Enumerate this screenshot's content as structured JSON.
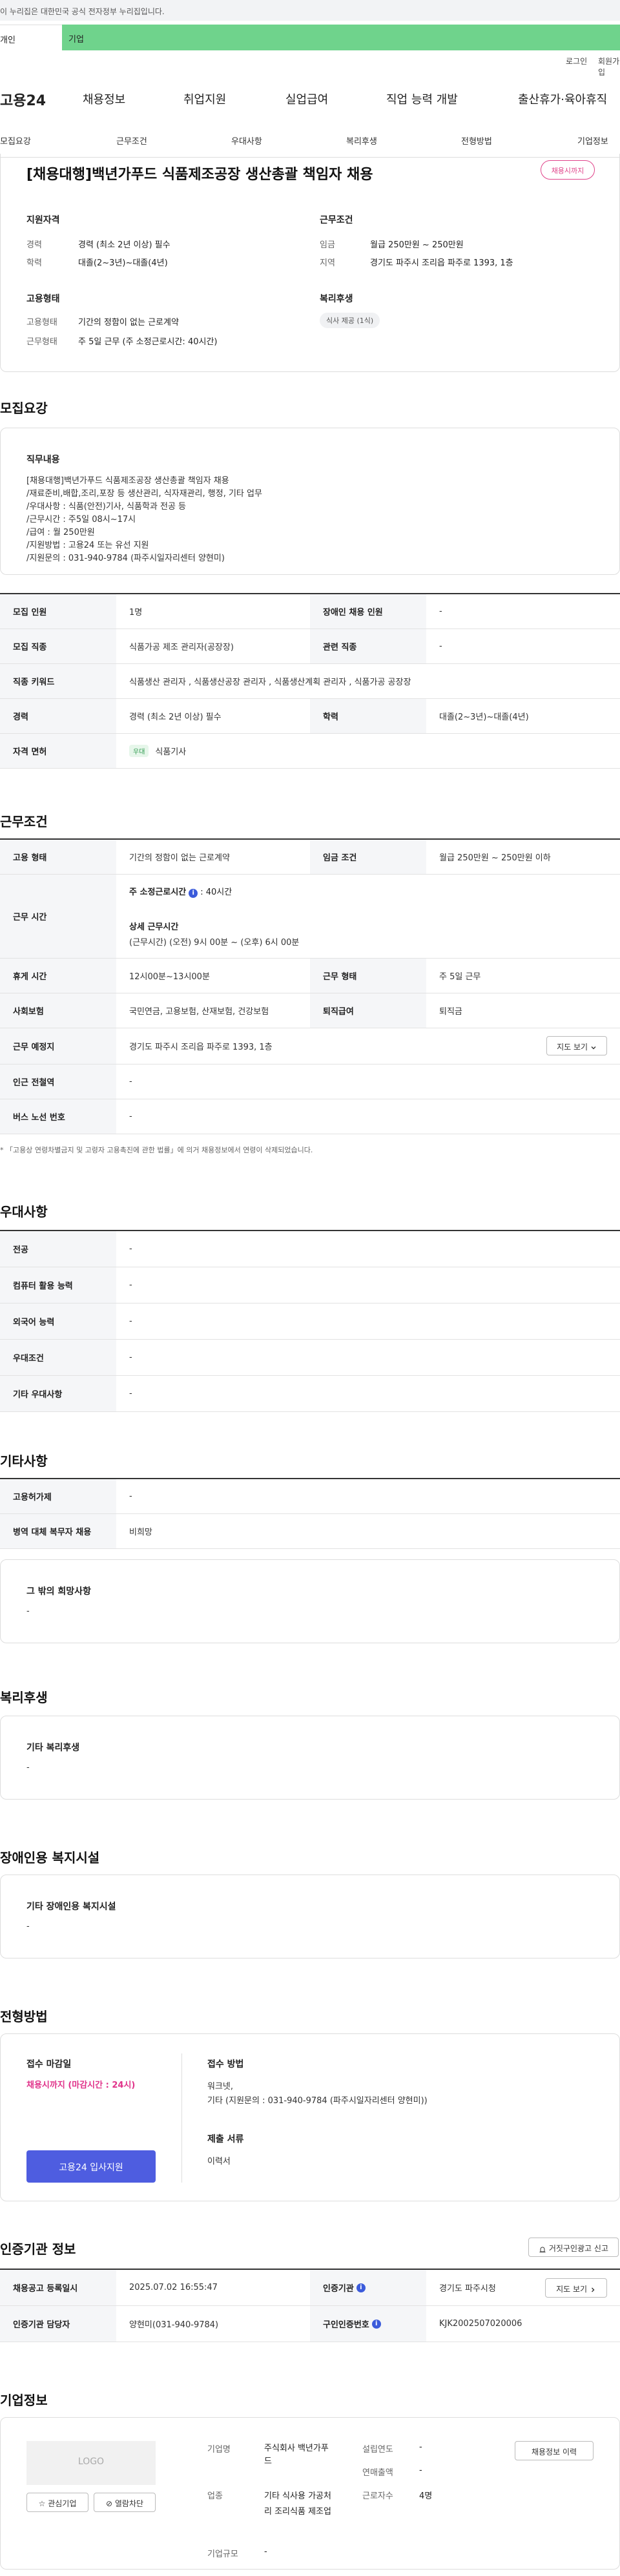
{
  "banner": {
    "text": "이 누리집은 대한민국 공식 전자정부 누리집입니다."
  },
  "tabs": {
    "personal": "개인",
    "company": "기업"
  },
  "util": {
    "login": "로그인",
    "join": "회원가입"
  },
  "gnb": {
    "logo": "고용24",
    "items": [
      "채용정보",
      "취업지원",
      "실업급여",
      "직업 능력 개발",
      "출산휴가·육아휴직"
    ]
  },
  "subnav": [
    "모집요강",
    "근무조건",
    "우대사항",
    "복리후생",
    "전형방법",
    "기업정보"
  ],
  "header": {
    "title": "[채용대행]백년가푸드 식품제조공장 생산총괄 책임자 채용",
    "deadline": "채용시까지",
    "qual": {
      "title": "지원자격",
      "career_k": "경력",
      "career_v": "경력 (최소 2년 이상) 필수",
      "edu_k": "학력",
      "edu_v": "대졸(2~3년)~대졸(4년)"
    },
    "work": {
      "title": "근무조건",
      "wage_k": "임금",
      "wage_v": "월급 250만원 ~ 250만원",
      "region_k": "지역",
      "region_v": "경기도 파주시 조리읍 파주로 1393, 1층"
    },
    "emp": {
      "title": "고용형태",
      "type_k": "고용형태",
      "type_v": "기간의 정함이 없는 근로계약",
      "hours_k": "근무형태",
      "hours_v": "주 5일 근무 (주 소정근로시간: 40시간)"
    },
    "welfare": {
      "title": "복리후생",
      "chip": "식사 제공 (1식)"
    }
  },
  "recruit": {
    "title": "모집요강",
    "duty_title": "직무내용",
    "duty_lines": [
      "[채용대행]백년가푸드 식품제조공장 생산총괄 책임자 채용",
      "/재료준비,배합,조리,포장 등 생산관리, 식자재관리, 행정, 기타 업무",
      "/우대사항 : 식품(안전)기사, 식품학과 전공 등",
      "/근무시간 : 주5일 08시~17시",
      "/급여 : 월 250만원",
      "/지원방법 : 고용24 또는 유선 지원",
      "/지원문의 : 031-940-9784 (파주시일자리센터 양현미)"
    ],
    "rows": [
      {
        "k1": "모집 인원",
        "v1": "1명",
        "k2": "장애인 채용 인원",
        "v2": "-"
      },
      {
        "k1": "모집 직종",
        "v1": "식품가공 제조 관리자(공장장)",
        "k2": "관련 직종",
        "v2": "-"
      },
      {
        "k1": "직종 키워드",
        "v1": "식품생산 관리자 , 식품생산공장 관리자 , 식품생산계획 관리자 , 식품가공 공장장"
      },
      {
        "k1": "경력",
        "v1": "경력 (최소 2년 이상) 필수",
        "k2": "학력",
        "v2": "대졸(2~3년)~대졸(4년)"
      },
      {
        "k1": "자격 면허",
        "chip": "우대",
        "v1": "식품기사"
      }
    ]
  },
  "work": {
    "title": "근무조건",
    "r1": {
      "k1": "고용 형태",
      "v1": "기간의 정함이 없는 근로계약",
      "k2": "임금 조건",
      "v2": "월급 250만원 ~ 250만원 이하"
    },
    "r2": {
      "k": "근무 시간",
      "line1_label": "주 소정근로시간",
      "line1_value": ": 40시간",
      "line2_label": "상세 근무시간",
      "line3": "(근무시간) (오전) 9시 00분 ~ (오후) 6시 00분"
    },
    "r3": {
      "k1": "휴게 시간",
      "v1": "12시00분~13시00분",
      "k2": "근무 형태",
      "v2": "주 5일 근무"
    },
    "r4": {
      "k1": "사회보험",
      "v1": "국민연금, 고용보험, 산재보험, 건강보험",
      "k2": "퇴직급여",
      "v2": "퇴직금"
    },
    "r5": {
      "k": "근무 예정지",
      "v": "경기도 파주시 조리읍 파주로 1393, 1층",
      "btn": "지도 보기"
    },
    "r6": {
      "k": "인근 전철역",
      "v": "-"
    },
    "r7": {
      "k": "버스 노선 번호",
      "v": "-"
    },
    "note": "* 「고용상 연령차별금지 및 고령자 고용촉진에 관한 법률」에 의거 채용정보에서 연령이 삭제되었습니다."
  },
  "pref": {
    "title": "우대사항",
    "rows": [
      {
        "k": "전공",
        "v": "-"
      },
      {
        "k": "컴퓨터 활용 능력",
        "v": "-"
      },
      {
        "k": "외국어 능력",
        "v": "-"
      },
      {
        "k": "우대조건",
        "v": "-"
      },
      {
        "k": "기타 우대사항",
        "v": "-"
      }
    ]
  },
  "etc": {
    "title": "기타사항",
    "rows": [
      {
        "k": "고용허가제",
        "v": "-"
      },
      {
        "k": "병역 대체 복무자 채용",
        "v": "비희망"
      }
    ],
    "box_title": "그 밖의 희망사항",
    "box_value": "-"
  },
  "welfare": {
    "title": "복리후생",
    "box_title": "기타 복리후생",
    "box_value": "-"
  },
  "disabled": {
    "title": "장애인용 복지시설",
    "box_title": "기타 장애인용 복지시설",
    "box_value": "-"
  },
  "selection": {
    "title": "전형방법",
    "deadline_label": "접수 마감일",
    "deadline_value": "채용시까지 (마감시간 : 24시)",
    "method_label": "접수 방법",
    "method_lines": [
      "워크넷,",
      "기타 (지원문의 : 031-940-9784 (파주시일자리센터 양현미))"
    ],
    "docs_label": "제출 서류",
    "docs_value": "이력서",
    "apply_btn": "고용24 입사지원"
  },
  "cert": {
    "title": "인증기관 정보",
    "report_btn": "거짓구인광고 신고",
    "r1": {
      "k1": "채용공고 등록일시",
      "v1": "2025.07.02 16:55:47",
      "k2": "인증기관",
      "v2": "경기도 파주시청",
      "btn": "지도 보기"
    },
    "r2": {
      "k1": "인증기관 담당자",
      "v1": "양현미(031-940-9784)",
      "k2": "구인인증번호",
      "v2": "KJK2002507020006"
    }
  },
  "company": {
    "title": "기업정보",
    "logo": "LOGO",
    "fav_btn": "관심기업",
    "block_btn": "열람차단",
    "name_k": "기업명",
    "name_v": "주식회사 백년가푸드",
    "est_k": "설립연도",
    "est_v": "-",
    "sales_k": "연매출액",
    "sales_v": "-",
    "ind_k": "업종",
    "ind_v": "기타 식사용 가공처리 조리식품 제조업",
    "emp_k": "근로자수",
    "emp_v": "4명",
    "size_k": "기업규모",
    "size_v": "-",
    "history_btn": "채용정보 이력"
  }
}
